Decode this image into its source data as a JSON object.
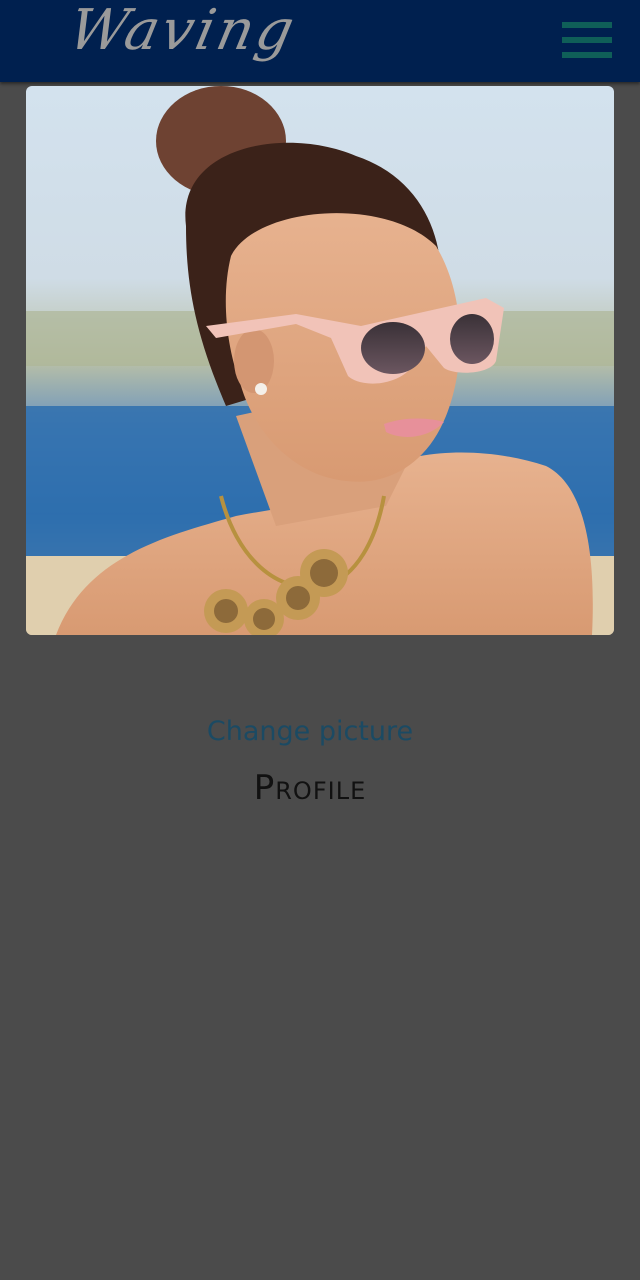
{
  "header": {
    "logo_text": "Waving",
    "menu_icon": "hamburger-menu-icon",
    "background_color": "#00204f",
    "menu_color": "#0f5f58"
  },
  "profile": {
    "photo": "profile-photo",
    "change_picture_label": "Change picture",
    "title": "Profile"
  },
  "colors": {
    "page_background": "#4b4b4b",
    "link": "#1b4a63"
  }
}
